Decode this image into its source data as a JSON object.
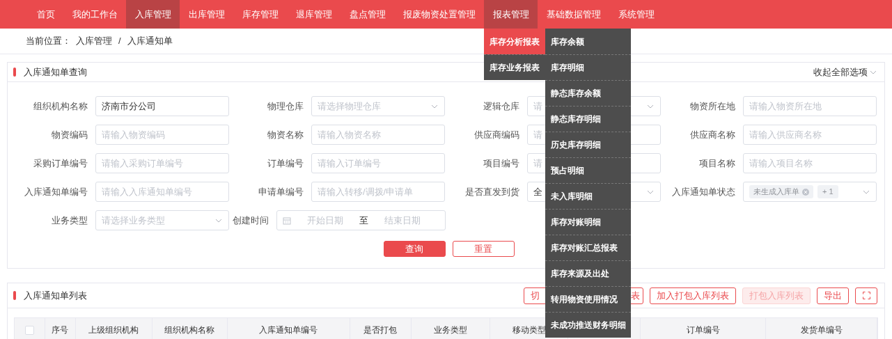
{
  "nav": {
    "items": [
      {
        "label": "首页",
        "selected": false
      },
      {
        "label": "我的工作台",
        "selected": false
      },
      {
        "label": "入库管理",
        "selected": true
      },
      {
        "label": "出库管理",
        "selected": false
      },
      {
        "label": "库存管理",
        "selected": false
      },
      {
        "label": "退库管理",
        "selected": false
      },
      {
        "label": "盘点管理",
        "selected": false
      },
      {
        "label": "报废物资处置管理",
        "selected": false
      },
      {
        "label": "报表管理",
        "selected": true
      },
      {
        "label": "基础数据管理",
        "selected": false
      },
      {
        "label": "系统管理",
        "selected": false
      }
    ]
  },
  "report_menu": {
    "groups": [
      {
        "label": "库存分析报表",
        "selected": true
      },
      {
        "label": "库存业务报表",
        "selected": false
      }
    ],
    "items": [
      "库存余额",
      "库存明细",
      "静态库存余额",
      "静态库存明细",
      "历史库存明细",
      "预占明细",
      "未入库明细",
      "库存对账明细",
      "库存对账汇总报表",
      "库存来源及出处",
      "转用物资使用情况",
      "未成功推送财务明细"
    ]
  },
  "breadcrumb": {
    "prefix": "当前位置：",
    "separator": "/",
    "path": [
      "入库管理",
      "入库通知单"
    ]
  },
  "query_panel": {
    "title": "入库通知单查询",
    "collapse": "收起全部选项",
    "fields": [
      {
        "label": "组织机构名称",
        "kind": "input",
        "value": "济南市分公司"
      },
      {
        "label": "物理仓库",
        "kind": "select",
        "placeholder": "请选择物理仓库"
      },
      {
        "label": "逻辑仓库",
        "kind": "select",
        "placeholder": "请"
      },
      {
        "label": "物资所在地",
        "kind": "input",
        "placeholder": "请输入物资所在地"
      },
      {
        "label": "物资编码",
        "kind": "input",
        "placeholder": "请输入物资编码"
      },
      {
        "label": "物资名称",
        "kind": "input",
        "placeholder": "请输入物资名称"
      },
      {
        "label": "供应商编码",
        "kind": "input",
        "placeholder": "请"
      },
      {
        "label": "供应商名称",
        "kind": "input",
        "placeholder": "请输入供应商名称"
      },
      {
        "label": "采购订单编号",
        "kind": "input",
        "placeholder": "请输入采购订单编号"
      },
      {
        "label": "订单编号",
        "kind": "input",
        "placeholder": "请输入订单编号"
      },
      {
        "label": "项目编号",
        "kind": "input",
        "placeholder": "请"
      },
      {
        "label": "项目名称",
        "kind": "input",
        "placeholder": "请输入项目名称"
      },
      {
        "label": "入库通知单编号",
        "kind": "input",
        "placeholder": "请输入入库通知单编号"
      },
      {
        "label": "申请单编号",
        "kind": "input",
        "placeholder": "请输入转移/调拨/申请单"
      },
      {
        "label": "是否直发到货",
        "kind": "select",
        "value": "全"
      },
      {
        "label": "入库通知单状态",
        "kind": "tags",
        "tags": [
          "未生成入库单"
        ],
        "more": "+ 1"
      },
      {
        "label": "业务类型",
        "kind": "select",
        "placeholder": "请选择业务类型"
      },
      {
        "label": "创建时间",
        "kind": "daterange",
        "start": "开始日期",
        "separator": "至",
        "end": "结束日期"
      }
    ],
    "buttons": [
      {
        "label": "查询",
        "kind": "primary"
      },
      {
        "label": "重置",
        "kind": "outline"
      }
    ]
  },
  "list_panel": {
    "title": "入库通知单列表",
    "buttons": [
      {
        "kind": "split",
        "parts": [
          "切",
          "表"
        ],
        "disabled": false
      },
      {
        "kind": "text",
        "label": "加入打包入库列表",
        "disabled": false
      },
      {
        "kind": "text",
        "label": "打包入库列表",
        "disabled": true
      },
      {
        "kind": "text",
        "label": "导出",
        "disabled": false
      },
      {
        "kind": "fullscreen",
        "disabled": false
      }
    ],
    "table": {
      "select_all_checked": false,
      "columns": [
        "序号",
        "上级组织机构",
        "组织机构名称",
        "入库通知单编号",
        "是否打包",
        "业务类型",
        "移动类型",
        "订单编号",
        "发货单编号"
      ]
    }
  }
}
